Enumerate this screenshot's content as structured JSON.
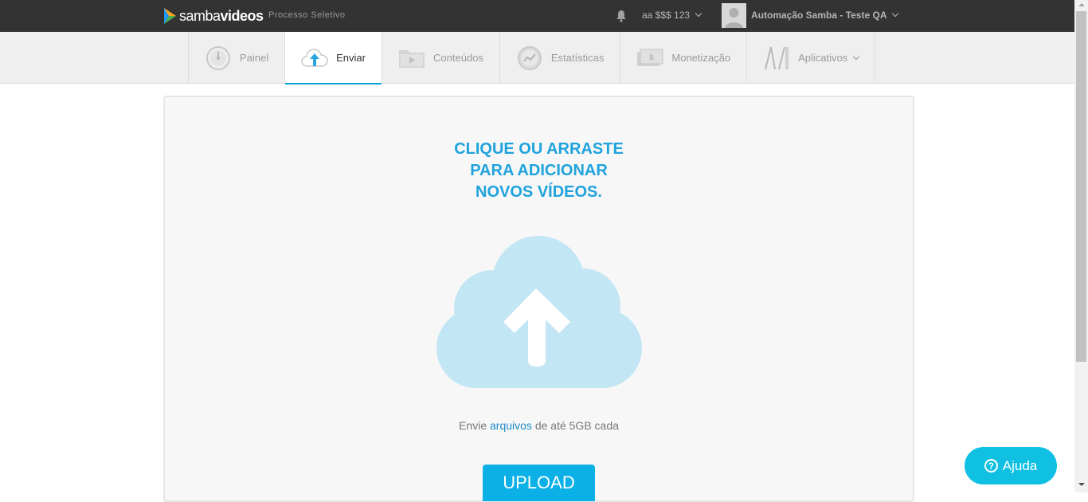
{
  "brand": {
    "samba": "samba",
    "videos": "videos",
    "subtitle": "Processo Seletivo"
  },
  "header": {
    "account_label": "aa $$$ 123",
    "user_name": "Automação Samba - Teste QA",
    "icons": [
      "bell-icon",
      "chevron-down-icon",
      "avatar"
    ]
  },
  "nav": {
    "tabs": [
      {
        "label": "Painel",
        "icon": "dashboard-gauge-icon",
        "active": false
      },
      {
        "label": "Enviar",
        "icon": "cloud-upload-icon",
        "active": true
      },
      {
        "label": "Conteúdos",
        "icon": "video-folder-icon",
        "active": false
      },
      {
        "label": "Estatísticas",
        "icon": "stats-chart-icon",
        "active": false
      },
      {
        "label": "Monetização",
        "icon": "money-bill-icon",
        "active": false
      },
      {
        "label": "Aplicativos",
        "icon": "apps-tools-icon",
        "active": false,
        "has_dropdown": true
      }
    ]
  },
  "upload": {
    "title_line1": "CLIQUE OU ARRASTE",
    "title_line2": "PARA ADICIONAR",
    "title_line3": "NOVOS VÍDEOS.",
    "hint_prefix": "Envie ",
    "hint_link": "arquivos",
    "hint_suffix": " de até 5GB cada",
    "button_label": "UPLOAD"
  },
  "help": {
    "label": "Ajuda",
    "icon_glyph": "?"
  },
  "colors": {
    "accent": "#00a0e0",
    "title": "#1fa3dd",
    "cloud": "#c3e6f5",
    "topbar": "#333333",
    "help": "#0fc0e2"
  }
}
